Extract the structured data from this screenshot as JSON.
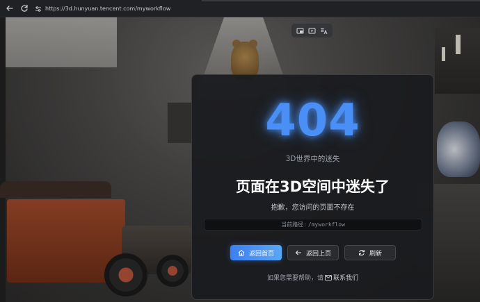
{
  "browser": {
    "url": "https://3d.hunyuan.tencent.com/myworkflow"
  },
  "toolbar": {
    "icons": [
      "picture-in-picture-icon",
      "video-icon",
      "translate-icon"
    ]
  },
  "error": {
    "code": "404",
    "subtitle": "3D世界中的迷失",
    "headline": "页面在3D空间中迷失了",
    "description": "抱歉，您访问的页面不存在",
    "path_label": "当前路径:",
    "path_value": "/myworkflow"
  },
  "actions": {
    "home_label": "返回首页",
    "back_label": "返回上页",
    "refresh_label": "刷新"
  },
  "help": {
    "prefix": "如果您需要帮助，请",
    "contact_label": "联系我们"
  },
  "colors": {
    "accent": "#4a8ff5",
    "card_bg": "#1a1b1e",
    "primary_button": "#3d7ff0"
  }
}
